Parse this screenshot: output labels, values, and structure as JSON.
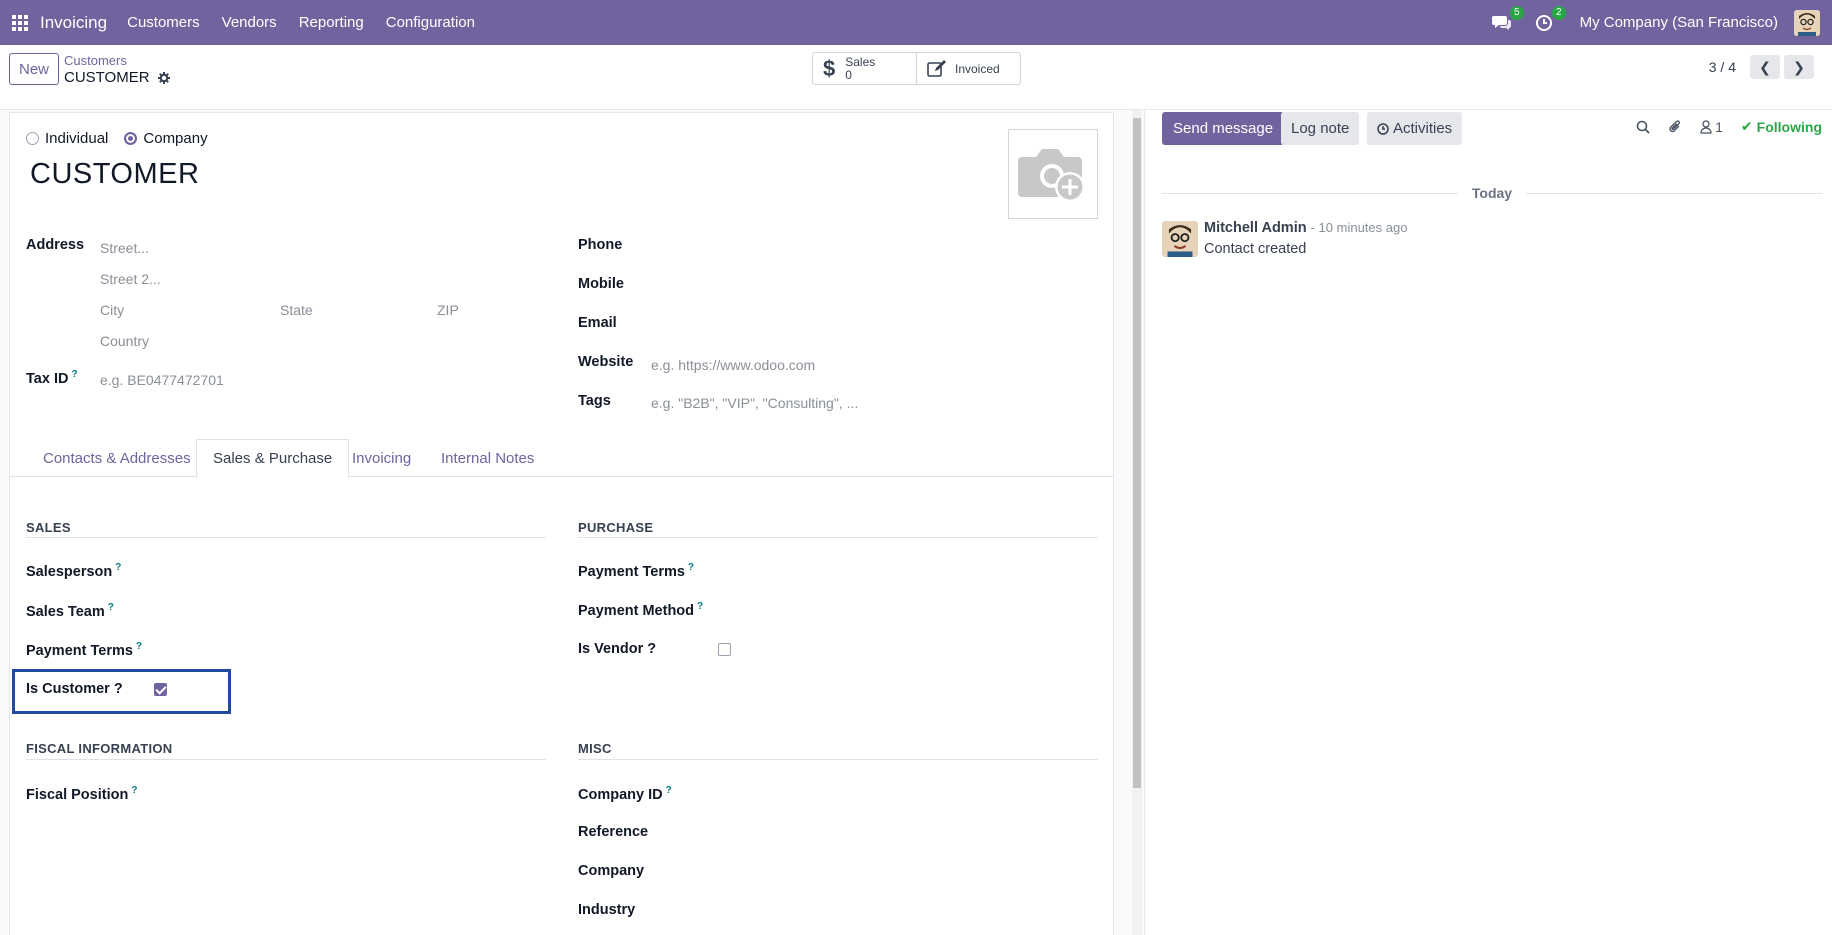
{
  "navbar": {
    "app_name": "Invoicing",
    "menu": [
      "Customers",
      "Vendors",
      "Reporting",
      "Configuration"
    ],
    "messages_count": "5",
    "activities_count": "2",
    "company": "My Company (San Francisco)"
  },
  "control_panel": {
    "new_label": "New",
    "breadcrumb_parent": "Customers",
    "breadcrumb_current": "CUSTOMER",
    "smart_sales_label": "Sales",
    "smart_sales_value": "0",
    "smart_invoiced_label": "Invoiced",
    "pager": "3 / 4"
  },
  "form": {
    "type_individual": "Individual",
    "type_company": "Company",
    "selected_type": "Company",
    "name": "CUSTOMER",
    "address_label": "Address",
    "street_ph": "Street...",
    "street2_ph": "Street 2...",
    "city_ph": "City",
    "state_ph": "State",
    "zip_ph": "ZIP",
    "country_ph": "Country",
    "tax_id_label": "Tax ID",
    "tax_id_ph": "e.g. BE0477472701",
    "phone_label": "Phone",
    "mobile_label": "Mobile",
    "email_label": "Email",
    "website_label": "Website",
    "website_ph": "e.g. https://www.odoo.com",
    "tags_label": "Tags",
    "tags_ph": "e.g. \"B2B\", \"VIP\", \"Consulting\", ..."
  },
  "tabs": [
    {
      "label": "Contacts & Addresses",
      "active": false
    },
    {
      "label": "Sales & Purchase",
      "active": true
    },
    {
      "label": "Invoicing",
      "active": false
    },
    {
      "label": "Internal Notes",
      "active": false
    }
  ],
  "sales": {
    "title": "SALES",
    "salesperson": "Salesperson",
    "sales_team": "Sales Team",
    "payment_terms": "Payment Terms",
    "is_customer": "Is Customer ?",
    "is_customer_checked": true
  },
  "purchase": {
    "title": "PURCHASE",
    "payment_terms": "Payment Terms",
    "payment_method": "Payment Method",
    "is_vendor": "Is Vendor ?",
    "is_vendor_checked": false
  },
  "fiscal": {
    "title": "FISCAL INFORMATION",
    "fiscal_position": "Fiscal Position"
  },
  "misc": {
    "title": "MISC",
    "company_id": "Company ID",
    "reference": "Reference",
    "company": "Company",
    "industry": "Industry"
  },
  "chatter": {
    "send_message": "Send message",
    "log_note": "Log note",
    "activities": "Activities",
    "followers_count": "1",
    "following": "Following",
    "today": "Today",
    "message_author": "Mitchell Admin",
    "message_time": "- 10 minutes ago",
    "message_body": "Contact created"
  },
  "colors": {
    "brand": "#71639e",
    "following": "#28a745",
    "highlight": "#1f4aa0"
  }
}
